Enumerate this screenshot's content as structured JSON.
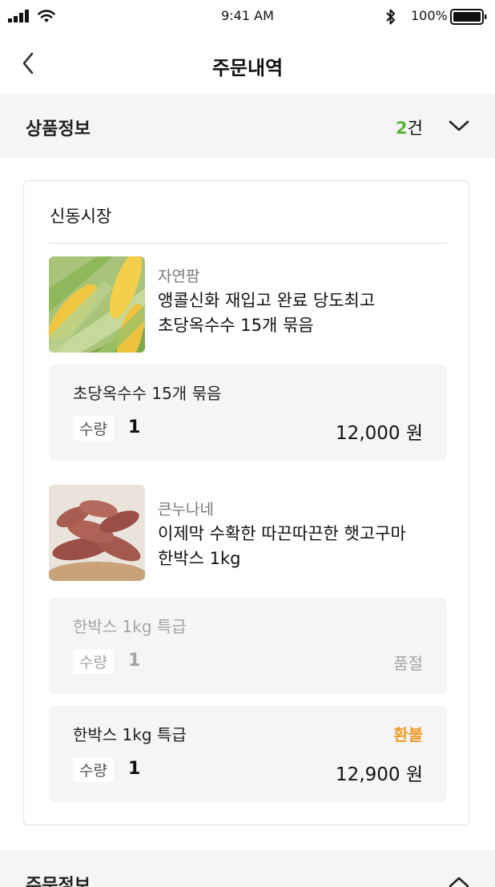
{
  "status": {
    "time": "9:41 AM",
    "battery": "100%"
  },
  "nav": {
    "title": "주문내역"
  },
  "product_section": {
    "title": "상품정보",
    "count_num": "2",
    "count_unit": "건"
  },
  "store": {
    "name": "신동시장"
  },
  "items": [
    {
      "seller": "자연팜",
      "name_line1": "앵콜신화 재입고 완료 당도최고",
      "name_line2": "초당옥수수 15개 묶음",
      "options": [
        {
          "name": "초당옥수수 15개 묶음",
          "qty_label": "수량",
          "qty": "1",
          "price": "12,000 원"
        }
      ]
    },
    {
      "seller": "큰누나네",
      "name_line1": "이제막 수확한 따끈따끈한 햇고구마",
      "name_line2": "한박스 1kg",
      "options": [
        {
          "name": "한박스 1kg 특급",
          "qty_label": "수량",
          "qty": "1",
          "status": "품절"
        },
        {
          "name": "한박스 1kg 특급",
          "qty_label": "수량",
          "qty": "1",
          "price": "12,900 원",
          "status": "환불"
        }
      ]
    }
  ],
  "order_section": {
    "title": "주문정보"
  },
  "colors": {
    "accent_green": "#5ab33a",
    "refund_orange": "#f09a2a",
    "soldout_gray": "#a5a5a5"
  },
  "icons": [
    "signal-icon",
    "wifi-icon",
    "bluetooth-icon",
    "battery-icon",
    "back-arrow-icon",
    "chevron-down-icon",
    "chevron-up-icon"
  ]
}
